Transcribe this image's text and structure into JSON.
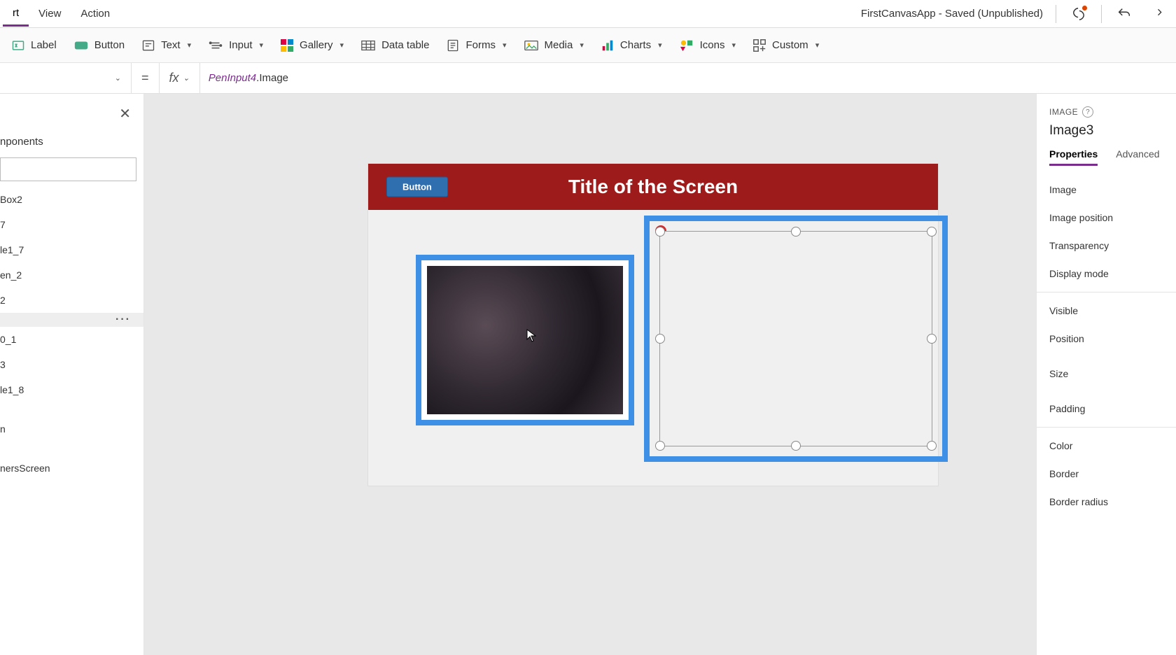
{
  "menubar": {
    "items": [
      "rt",
      "View",
      "Action"
    ],
    "active_index": 0,
    "app_title": "FirstCanvasApp - Saved (Unpublished)"
  },
  "ribbon": {
    "label_btn": "Label",
    "button_btn": "Button",
    "text_btn": "Text",
    "input_btn": "Input",
    "gallery_btn": "Gallery",
    "datatable_btn": "Data table",
    "forms_btn": "Forms",
    "media_btn": "Media",
    "charts_btn": "Charts",
    "icons_btn": "Icons",
    "custom_btn": "Custom"
  },
  "formula": {
    "property": "",
    "eq": "=",
    "fx": "fx",
    "expr_name": "PenInput4",
    "expr_dot": ".",
    "expr_prop": "Image"
  },
  "tree": {
    "tab": "nponents",
    "items": [
      "Box2",
      "7",
      "le1_7",
      "en_2",
      "2",
      "",
      "0_1",
      "3",
      "le1_8",
      "",
      "n",
      "",
      "nersScreen"
    ],
    "selected_index": 5
  },
  "canvas": {
    "header_button": "Button",
    "header_title": "Title of the Screen",
    "error_badge": "×",
    "error_chev": "⌄"
  },
  "props": {
    "category": "IMAGE",
    "object": "Image3",
    "tabs": [
      "Properties",
      "Advanced"
    ],
    "active_tab": 0,
    "rows_a": [
      "Image",
      "Image position",
      "Transparency",
      "Display mode"
    ],
    "rows_b": [
      "Visible",
      "Position",
      "Size",
      "Padding"
    ],
    "rows_c": [
      "Color",
      "Border",
      "Border radius"
    ]
  }
}
